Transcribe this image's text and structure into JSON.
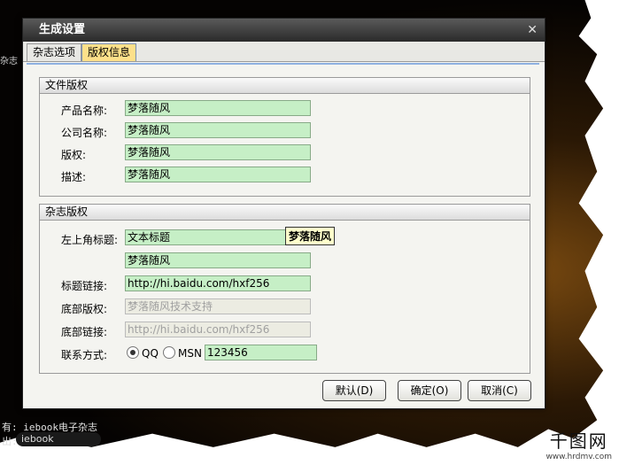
{
  "dialog": {
    "title": "生成设置"
  },
  "tabs": [
    {
      "label": "杂志选项"
    },
    {
      "label": "版权信息",
      "active": true
    }
  ],
  "file_copyright": {
    "title": "文件版权",
    "fields": [
      {
        "label": "产品名称:",
        "value": "梦落随风"
      },
      {
        "label": "公司名称:",
        "value": "梦落随风"
      },
      {
        "label": "版权:",
        "value": "梦落随风"
      },
      {
        "label": "描述:",
        "value": "梦落随风"
      }
    ]
  },
  "magazine_copyright": {
    "title": "杂志版权",
    "top_left_title": {
      "label": "左上角标题:",
      "value": "文本标题",
      "tooltip": "梦落随风"
    },
    "title_text": {
      "value": "梦落随风"
    },
    "title_link": {
      "label": "标题链接:",
      "value": "http://hi.baidu.com/hxf256"
    },
    "footer_copyright": {
      "label": "底部版权:",
      "value": "梦落随风技术支持"
    },
    "footer_link": {
      "label": "底部链接:",
      "value": "http://hi.baidu.com/hxf256"
    },
    "contact": {
      "label": "联系方式:",
      "option_qq": "QQ",
      "option_msn": "MSN",
      "value": "123456",
      "selected": "QQ"
    }
  },
  "buttons": {
    "default": "默认(D)",
    "ok": "确定(O)",
    "cancel": "取消(C)"
  },
  "background": {
    "line1": "有: iebook电子杂志",
    "line2": "出:",
    "side_text": "杂志",
    "logo_text": "iebook"
  },
  "watermark": {
    "site": "千图网",
    "url": "www.hrdmv.com"
  },
  "colors": {
    "field_bg": "#c6efc6",
    "active_tab": "#fde08a",
    "titlebar": "#3a3a3a"
  }
}
